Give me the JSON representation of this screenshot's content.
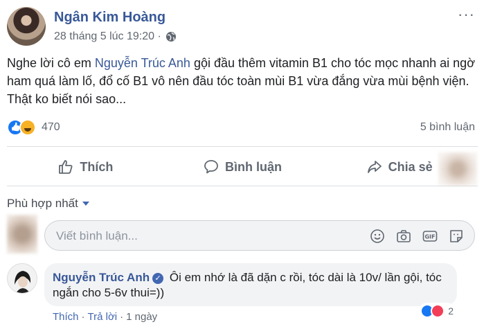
{
  "post": {
    "author": "Ngân Kim Hoàng",
    "timestamp": "28 tháng 5 lúc 19:20 ·",
    "more": "···",
    "text_before": "Nghe lời cô em ",
    "mention": "Nguyễn Trúc Anh",
    "text_after": " gội đầu thêm vitamin B1 cho tóc mọc nhanh ai ngờ ham quá làm lố, đổ cố B1 vô nên đầu tóc toàn mùi B1 vừa đắng vừa mùi bệnh viện. Thật ko biết nói sao...",
    "reaction_count": "470",
    "comment_count": "5 bình luận"
  },
  "actions": {
    "like": "Thích",
    "comment": "Bình luận",
    "share": "Chia sẻ"
  },
  "comments": {
    "sort_label": "Phù hợp nhất",
    "input_placeholder": "Viết bình luận...",
    "items": [
      {
        "author": "Nguyễn Trúc Anh",
        "verified_mark": "✓",
        "text": "Ôi em nhớ là đã dặn c rồi, tóc dài là 10v/ lần gội, tóc ngắn cho 5-6v thui=))",
        "reaction_count": "2",
        "like_label": "Thích",
        "separator": "·",
        "reply_label": "Trả lời",
        "age": "1 ngày"
      }
    ]
  },
  "icons": [
    "globe-icon",
    "more-icon",
    "like-icon",
    "comment-icon",
    "share-icon",
    "caret-down-icon",
    "emoji-icon",
    "camera-icon",
    "gif-icon",
    "sticker-icon",
    "verified-icon"
  ],
  "colors": {
    "link": "#385898",
    "muted": "#606770",
    "like_blue": "#1877f2",
    "love_red": "#f33e58",
    "haha_yellow": "#f7b125"
  }
}
